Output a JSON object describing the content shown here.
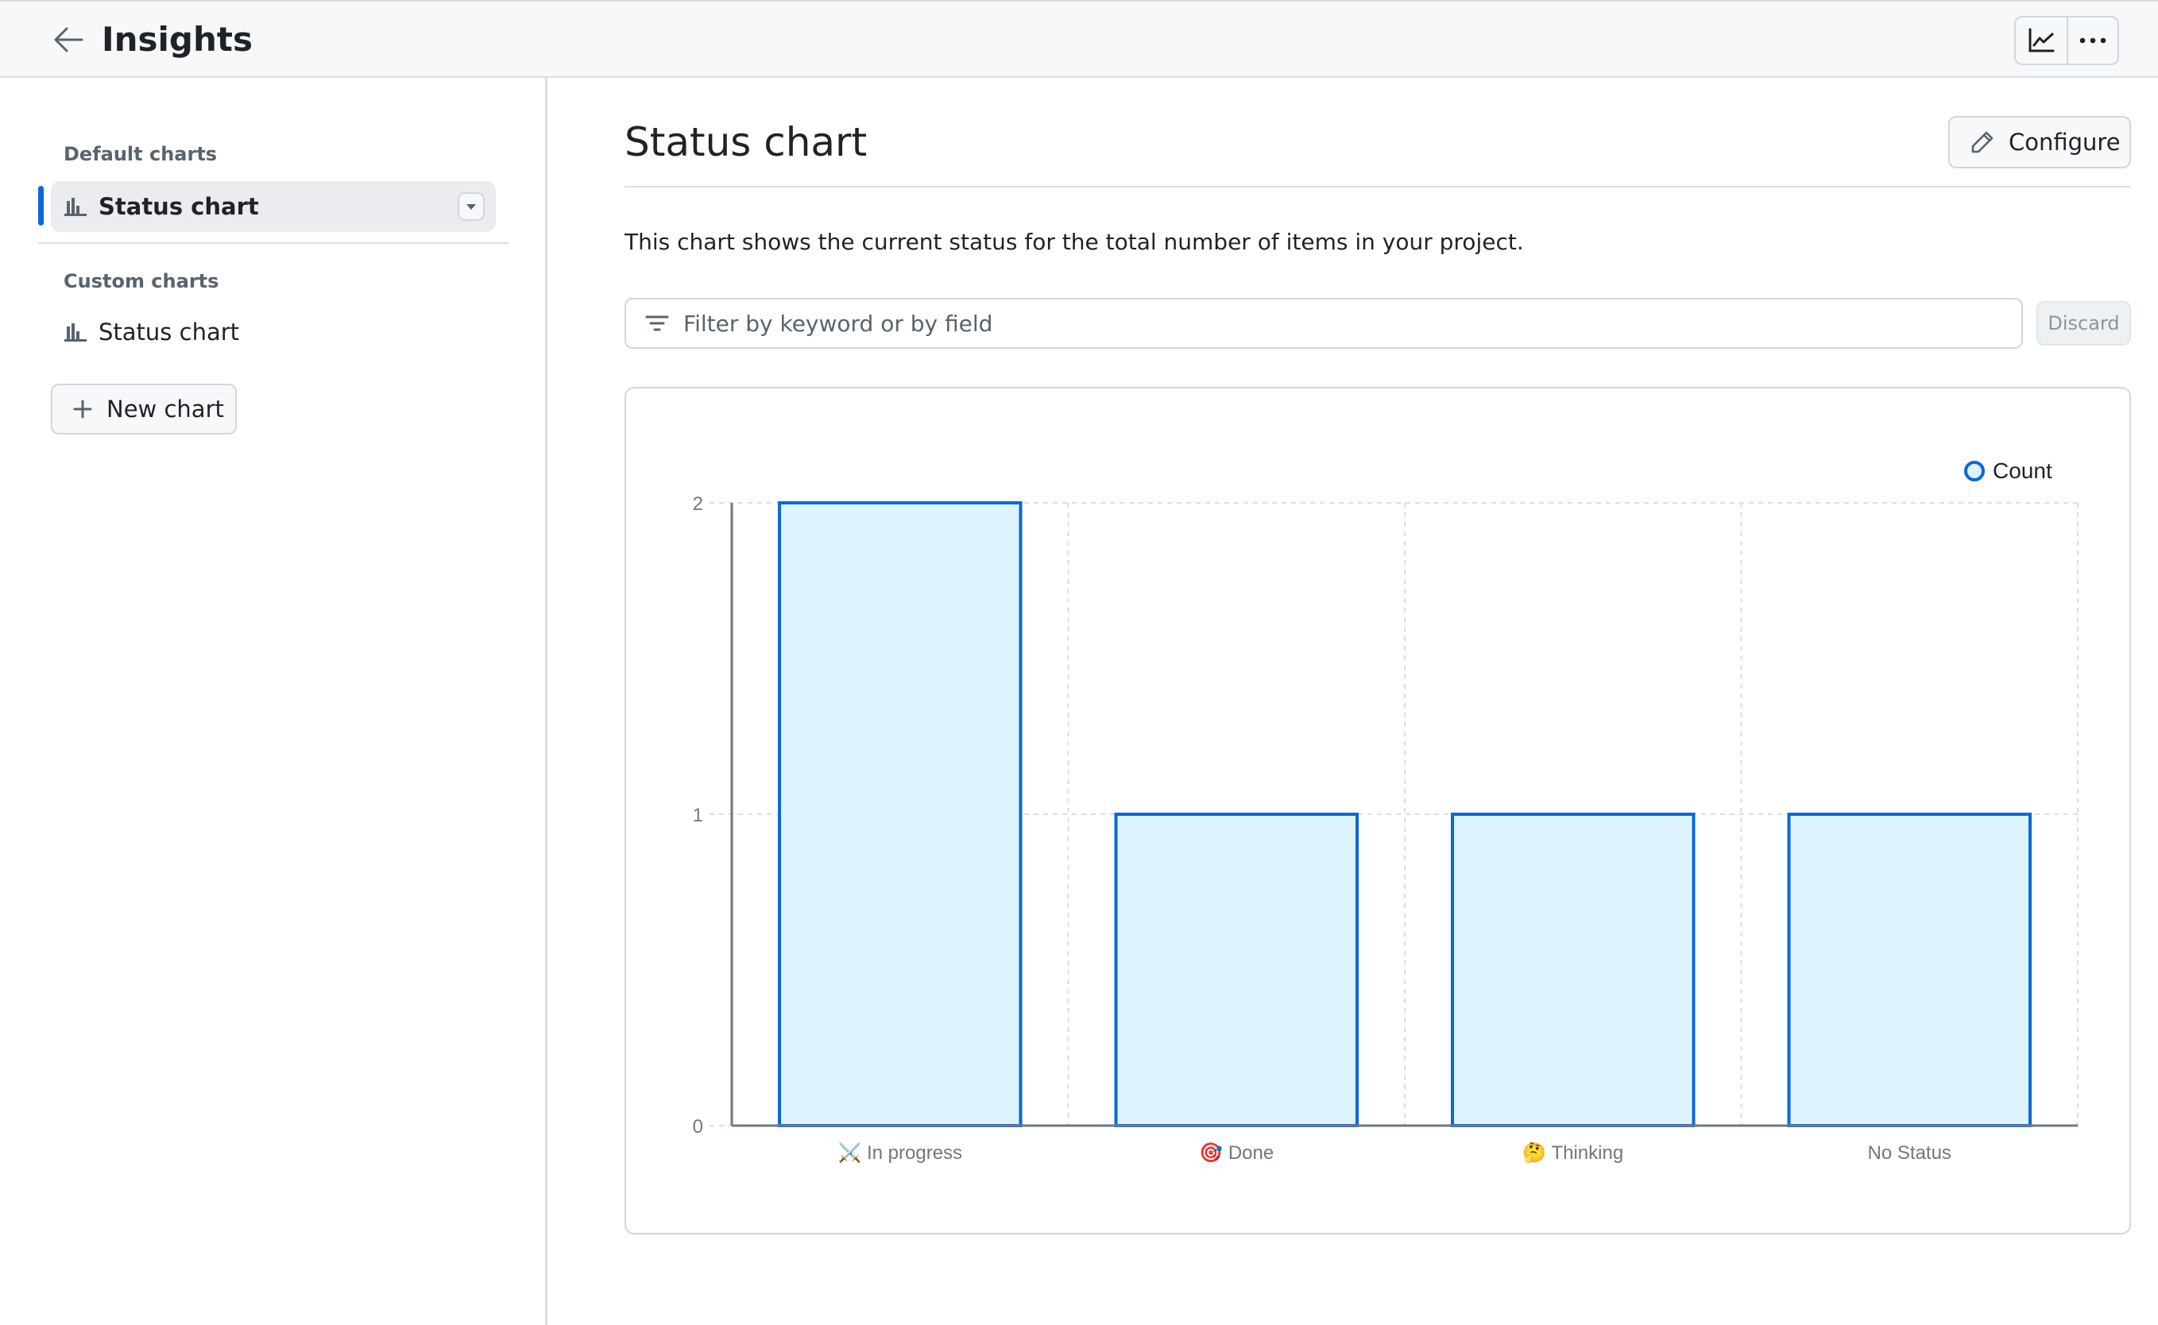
{
  "header": {
    "title": "Insights",
    "back_icon": "arrow-left-icon",
    "actions": [
      {
        "name": "chart-view",
        "icon": "graph-icon"
      },
      {
        "name": "more-options",
        "icon": "kebab-horizontal-icon"
      }
    ]
  },
  "sidebar": {
    "default_section_label": "Default charts",
    "default_items": [
      {
        "label": "Status chart",
        "icon": "bar-chart-icon",
        "active": true
      }
    ],
    "custom_section_label": "Custom charts",
    "custom_items": [
      {
        "label": "Status chart",
        "icon": "bar-chart-icon",
        "active": false
      }
    ],
    "new_chart_label": "New chart"
  },
  "main": {
    "title": "Status chart",
    "configure_label": "Configure",
    "description": "This chart shows the current status for the total number of items in your project.",
    "filter": {
      "placeholder": "Filter by keyword or by field",
      "value": ""
    },
    "discard_label": "Discard"
  },
  "colors": {
    "accent": "#0969da",
    "bar_fill": "#ddf4ff",
    "axis": "#6e7781",
    "grid": "#d8dee4",
    "tick_text": "#6e7781"
  },
  "chart_data": {
    "type": "bar",
    "title": "",
    "xlabel": "",
    "ylabel": "",
    "categories": [
      "⚔️ In progress",
      "🎯 Done",
      "🤔 Thinking",
      "No Status"
    ],
    "series": [
      {
        "name": "Count",
        "values": [
          2,
          1,
          1,
          1
        ]
      }
    ],
    "yticks": [
      0,
      1,
      2
    ],
    "ylim": [
      0,
      2
    ],
    "grid": true,
    "legend": "top-right"
  }
}
